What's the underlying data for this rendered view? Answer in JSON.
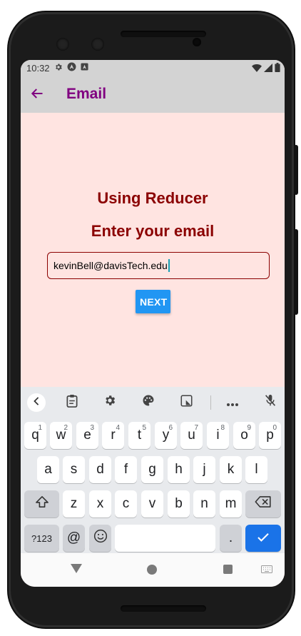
{
  "statusbar": {
    "time": "10:32",
    "icons": [
      "gear-icon",
      "a-circle-icon",
      "a-square-icon",
      "wifi-icon",
      "signal-icon",
      "battery-icon"
    ]
  },
  "appbar": {
    "title": "Email",
    "back_icon": "arrow-left-icon",
    "color": "#800080",
    "background": "#d3d3d3"
  },
  "main": {
    "background": "#ffe4e1",
    "heading1": "Using Reducer",
    "heading2": "Enter your email",
    "heading_color": "#8b0000",
    "email_value": "kevinBell@davisTech.edu",
    "next_label": "NEXT",
    "button_color": "#2196f3"
  },
  "keyboard": {
    "toolbar_icons": [
      "chevron-left-icon",
      "clipboard-icon",
      "settings-icon",
      "palette-icon",
      "floating-keyboard-icon",
      "more-icon",
      "mic-off-icon"
    ],
    "row1": [
      {
        "key": "q",
        "hint": "1"
      },
      {
        "key": "w",
        "hint": "2"
      },
      {
        "key": "e",
        "hint": "3"
      },
      {
        "key": "r",
        "hint": "4"
      },
      {
        "key": "t",
        "hint": "5"
      },
      {
        "key": "y",
        "hint": "6"
      },
      {
        "key": "u",
        "hint": "7"
      },
      {
        "key": "i",
        "hint": "8"
      },
      {
        "key": "o",
        "hint": "9"
      },
      {
        "key": "p",
        "hint": "0"
      }
    ],
    "row2": [
      "a",
      "s",
      "d",
      "f",
      "g",
      "h",
      "j",
      "k",
      "l"
    ],
    "row3": [
      "z",
      "x",
      "c",
      "v",
      "b",
      "n",
      "m"
    ],
    "shift_icon": "shift-icon",
    "backspace_icon": "backspace-icon",
    "symbols_label": "?123",
    "at_label": "@",
    "emoji_icon": "emoji-icon",
    "period_label": ".",
    "enter_icon": "checkmark-icon"
  },
  "navbar": {
    "icons": [
      "back-triangle-icon",
      "home-circle-icon",
      "recents-square-icon",
      "keyboard-switch-icon"
    ]
  }
}
